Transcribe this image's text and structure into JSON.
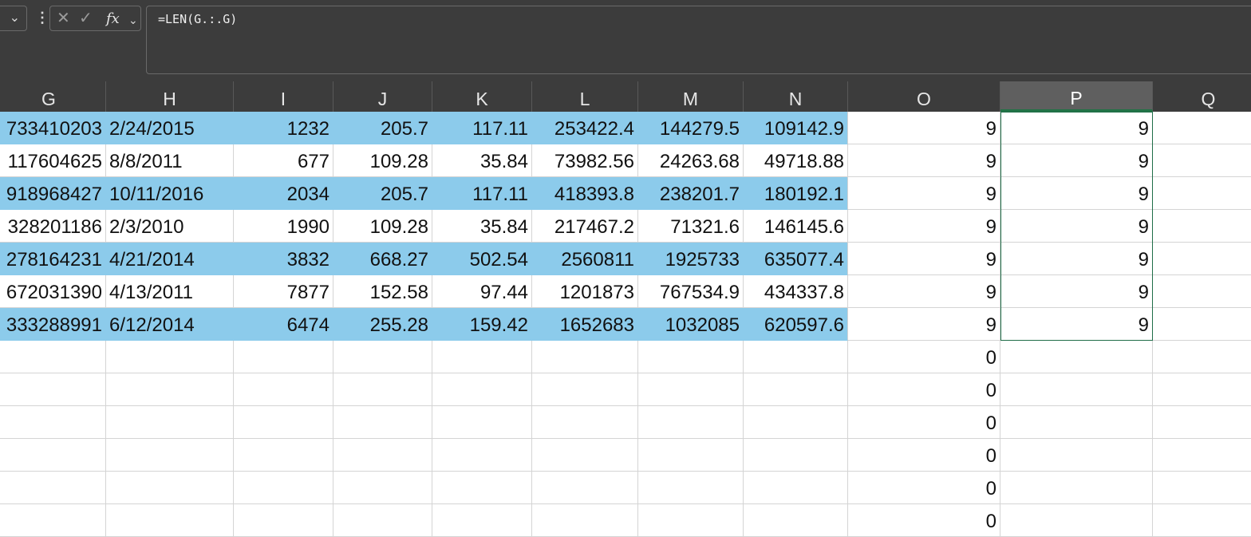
{
  "formula_bar": {
    "formula": "=LEN(G.:.G)",
    "fx_label": "fx",
    "cancel_glyph": "✕",
    "enter_glyph": "✓",
    "dropdown_glyph": "⌄",
    "more_glyph": "⋮"
  },
  "columns": [
    "G",
    "H",
    "I",
    "J",
    "K",
    "L",
    "M",
    "N",
    "O",
    "P",
    "Q"
  ],
  "selected_column": "P",
  "rows": [
    {
      "band": true,
      "cells": [
        "733410203",
        "2/24/2015",
        "1232",
        "205.7",
        "117.11",
        "253422.4",
        "144279.5",
        "109142.9",
        "9",
        "9",
        ""
      ]
    },
    {
      "band": false,
      "cells": [
        "117604625",
        "8/8/2011",
        "677",
        "109.28",
        "35.84",
        "73982.56",
        "24263.68",
        "49718.88",
        "9",
        "9",
        ""
      ]
    },
    {
      "band": true,
      "cells": [
        "918968427",
        "10/11/2016",
        "2034",
        "205.7",
        "117.11",
        "418393.8",
        "238201.7",
        "180192.1",
        "9",
        "9",
        ""
      ]
    },
    {
      "band": false,
      "cells": [
        "328201186",
        "2/3/2010",
        "1990",
        "109.28",
        "35.84",
        "217467.2",
        "71321.6",
        "146145.6",
        "9",
        "9",
        ""
      ]
    },
    {
      "band": true,
      "cells": [
        "278164231",
        "4/21/2014",
        "3832",
        "668.27",
        "502.54",
        "2560811",
        "1925733",
        "635077.4",
        "9",
        "9",
        ""
      ]
    },
    {
      "band": false,
      "cells": [
        "672031390",
        "4/13/2011",
        "7877",
        "152.58",
        "97.44",
        "1201873",
        "767534.9",
        "434337.8",
        "9",
        "9",
        ""
      ]
    },
    {
      "band": true,
      "cells": [
        "333288991",
        "6/12/2014",
        "6474",
        "255.28",
        "159.42",
        "1652683",
        "1032085",
        "620597.6",
        "9",
        "9",
        ""
      ]
    },
    {
      "band": false,
      "cells": [
        "",
        "",
        "",
        "",
        "",
        "",
        "",
        "",
        "0",
        "",
        ""
      ]
    },
    {
      "band": false,
      "cells": [
        "",
        "",
        "",
        "",
        "",
        "",
        "",
        "",
        "0",
        "",
        ""
      ]
    },
    {
      "band": false,
      "cells": [
        "",
        "",
        "",
        "",
        "",
        "",
        "",
        "",
        "0",
        "",
        ""
      ]
    },
    {
      "band": false,
      "cells": [
        "",
        "",
        "",
        "",
        "",
        "",
        "",
        "",
        "0",
        "",
        ""
      ]
    },
    {
      "band": false,
      "cells": [
        "",
        "",
        "",
        "",
        "",
        "",
        "",
        "",
        "0",
        "",
        ""
      ]
    },
    {
      "band": false,
      "cells": [
        "",
        "",
        "",
        "",
        "",
        "",
        "",
        "",
        "0",
        "",
        ""
      ]
    }
  ],
  "colors": {
    "band_fill": "#8ccbeb",
    "header_bg": "#3c3c3c",
    "selection_border": "#1f6d48"
  }
}
